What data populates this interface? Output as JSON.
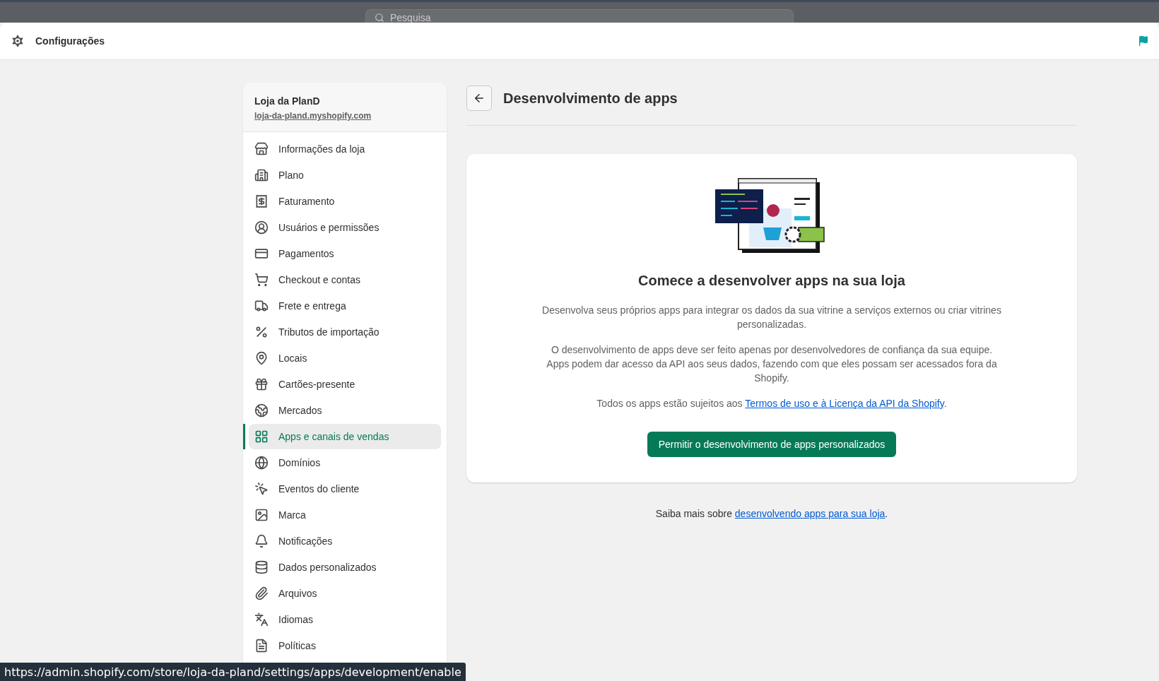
{
  "backdrop": {
    "search": {
      "placeholder": "Pesquisa"
    }
  },
  "header": {
    "title": "Configurações"
  },
  "store": {
    "name": "Loja da PlanD",
    "url": "loja-da-pland.myshopify.com"
  },
  "sidebar": {
    "items": [
      {
        "label": "Informações da loja",
        "selected": false
      },
      {
        "label": "Plano",
        "selected": false
      },
      {
        "label": "Faturamento",
        "selected": false
      },
      {
        "label": "Usuários e permissões",
        "selected": false
      },
      {
        "label": "Pagamentos",
        "selected": false
      },
      {
        "label": "Checkout e contas",
        "selected": false
      },
      {
        "label": "Frete e entrega",
        "selected": false
      },
      {
        "label": "Tributos de importação",
        "selected": false
      },
      {
        "label": "Locais",
        "selected": false
      },
      {
        "label": "Cartões-presente",
        "selected": false
      },
      {
        "label": "Mercados",
        "selected": false
      },
      {
        "label": "Apps e canais de vendas",
        "selected": true
      },
      {
        "label": "Domínios",
        "selected": false
      },
      {
        "label": "Eventos do cliente",
        "selected": false
      },
      {
        "label": "Marca",
        "selected": false
      },
      {
        "label": "Notificações",
        "selected": false
      },
      {
        "label": "Dados personalizados",
        "selected": false
      },
      {
        "label": "Arquivos",
        "selected": false
      },
      {
        "label": "Idiomas",
        "selected": false
      },
      {
        "label": "Políticas",
        "selected": false
      }
    ]
  },
  "page": {
    "title": "Desenvolvimento de apps",
    "card": {
      "heading": "Comece a desenvolver apps na sua loja",
      "paragraphs": [
        "Desenvolva seus próprios apps para integrar os dados da sua vitrine a serviços externos ou criar vitrines personalizadas.",
        "O desenvolvimento de apps deve ser feito apenas por desenvolvedores de confiança da sua equipe. Apps podem dar acesso da API aos seus dados, fazendo com que eles possam ser acessados fora da Shopify."
      ],
      "terms": {
        "before": "Todos os apps estão sujeitos aos ",
        "link": "Termos de uso e à Licença da API da Shopify",
        "after": "."
      },
      "button": "Permitir o desenvolvimento de apps personalizados"
    },
    "footer": {
      "before": "Saiba mais sobre ",
      "link": "desenvolvendo apps para sua loja",
      "after": "."
    }
  },
  "status_bar": {
    "url": "https://admin.shopify.com/store/loja-da-pland/settings/apps/development/enable"
  }
}
